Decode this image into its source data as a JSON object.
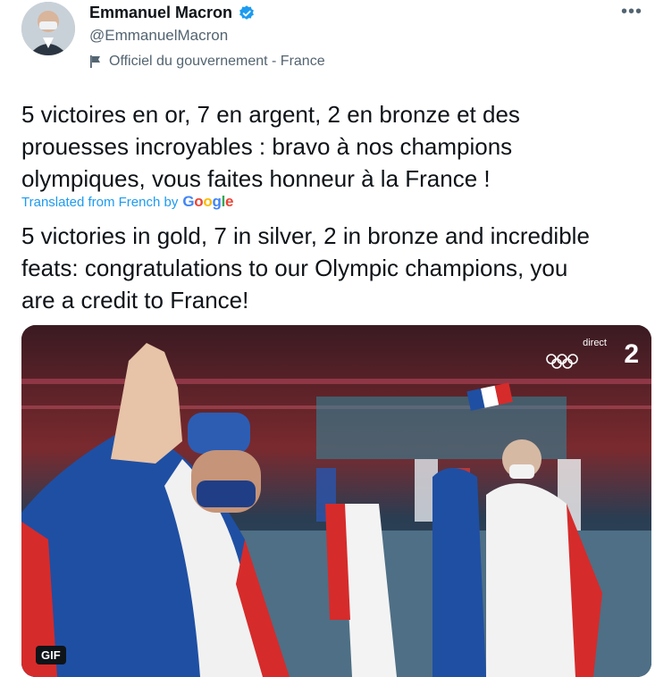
{
  "author": {
    "name": "Emmanuel Macron",
    "handle": "@EmmanuelMacron",
    "label": "Officiel du gouvernement - France"
  },
  "tweet": {
    "original_text": "5 victoires en or, 7 en argent, 2 en bronze et des\nprouesses incroyables : bravo à nos champions\nolympiques, vous faites honneur à la France !",
    "translated_by": "Translated from French by",
    "provider": "Google",
    "translated_text": "5 victories in gold, 7 in silver, 2 in bronze and incredible\nfeats: congratulations to our Olympic champions, you\nare a credit to France!"
  },
  "media": {
    "gif_label": "GIF",
    "tv_badge": "direct",
    "tv_channel": "2"
  },
  "colors": {
    "link": "#1d9bf0",
    "verified": "#1d9bf0",
    "flag_blue": "#1f4fa3",
    "flag_red": "#d62b2b"
  },
  "icons": [
    "more-icon",
    "verified-icon",
    "flag-icon",
    "olympic-rings-icon"
  ]
}
